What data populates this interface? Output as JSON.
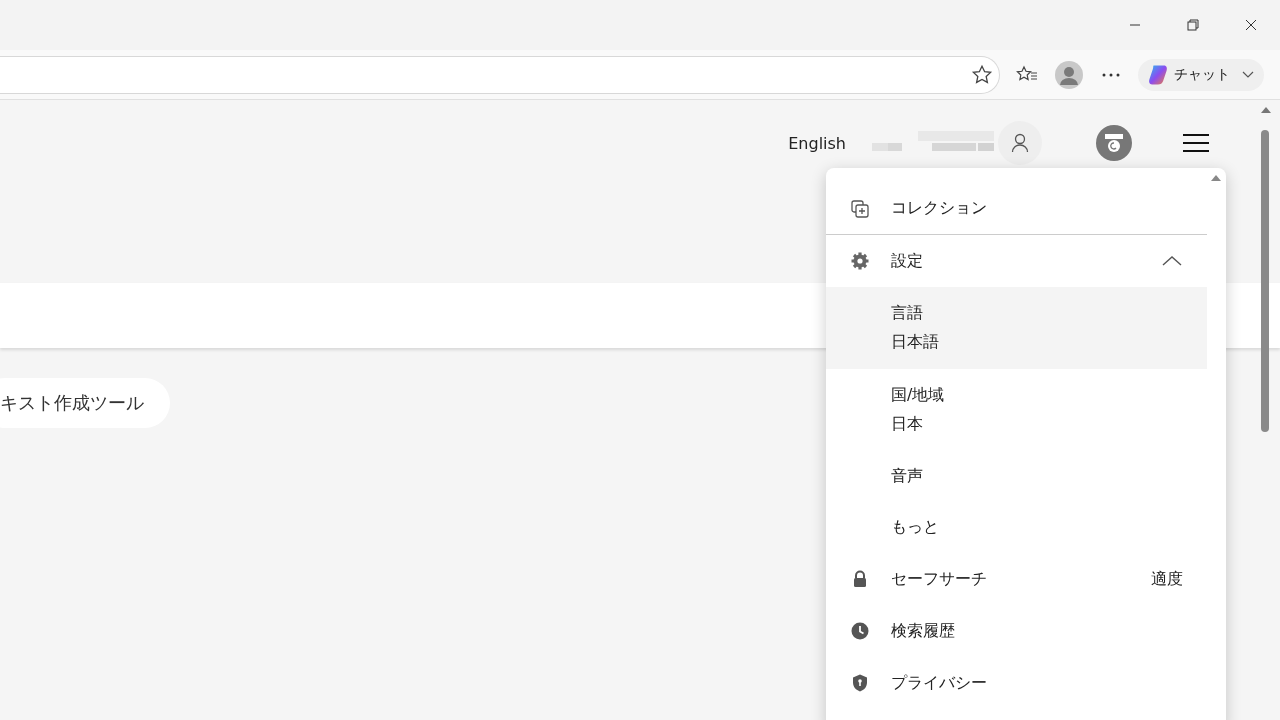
{
  "browser": {
    "chat_label": "チャット"
  },
  "page": {
    "language_link": "English",
    "tool_pill": "キスト作成ツール"
  },
  "menu": {
    "items": [
      {
        "kind": "link",
        "label": "コレクション"
      },
      {
        "kind": "section",
        "label": "設定",
        "expanded": true,
        "children": [
          {
            "label": "言語",
            "value": "日本語",
            "selected": true
          },
          {
            "label": "国/地域",
            "value": "日本",
            "selected": false
          },
          {
            "label": "音声",
            "selected": false
          },
          {
            "label": "もっと",
            "selected": false
          }
        ]
      },
      {
        "kind": "link",
        "label": "セーフサーチ",
        "value": "適度"
      },
      {
        "kind": "link",
        "label": "検索履歴"
      },
      {
        "kind": "link",
        "label": "プライバシー"
      }
    ]
  }
}
